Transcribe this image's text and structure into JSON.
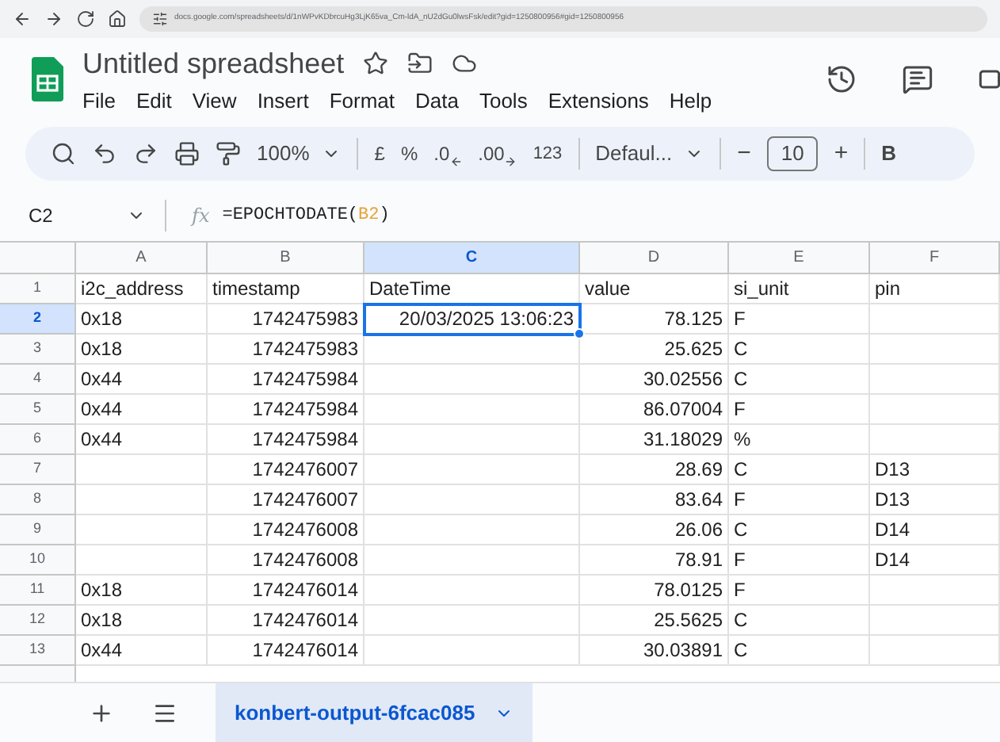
{
  "browser": {
    "url": "docs.google.com/spreadsheets/d/1nWPvKDbrcuHg3LjK65va_Cm-ldA_nU2dGu0lwsFsk/edit?gid=1250800956#gid=1250800956"
  },
  "document": {
    "title": "Untitled spreadsheet",
    "menu": [
      "File",
      "Edit",
      "View",
      "Insert",
      "Format",
      "Data",
      "Tools",
      "Extensions",
      "Help"
    ]
  },
  "toolbar": {
    "zoom": "100%",
    "currency": "£",
    "percent": "%",
    "decrease_decimals": ".0",
    "increase_decimals": ".00",
    "number_format": "123",
    "font": "Defaul...",
    "font_size_decrease": "−",
    "font_size": "10",
    "font_size_increase": "+",
    "bold": "B"
  },
  "formula_bar": {
    "cell_ref": "C2",
    "function_label": "fx",
    "formula_prefix": "=EPOCHTODATE(",
    "formula_ref": "B2",
    "formula_suffix": ")"
  },
  "columns": [
    {
      "label": "A",
      "selected": false
    },
    {
      "label": "B",
      "selected": false
    },
    {
      "label": "C",
      "selected": true
    },
    {
      "label": "D",
      "selected": false
    },
    {
      "label": "E",
      "selected": false
    },
    {
      "label": "F",
      "selected": false
    }
  ],
  "rows": [
    {
      "number": "1",
      "selected": false,
      "cells": [
        "i2c_address",
        "timestamp",
        "DateTime",
        "value",
        "si_unit",
        "pin"
      ]
    },
    {
      "number": "2",
      "selected": true,
      "cells": [
        "0x18",
        "1742475983",
        "20/03/2025 13:06:23",
        "78.125",
        "F",
        null
      ]
    },
    {
      "number": "3",
      "selected": false,
      "cells": [
        "0x18",
        "1742475983",
        null,
        "25.625",
        "C",
        null
      ]
    },
    {
      "number": "4",
      "selected": false,
      "cells": [
        "0x44",
        "1742475984",
        null,
        "30.02556",
        "C",
        null
      ]
    },
    {
      "number": "5",
      "selected": false,
      "cells": [
        "0x44",
        "1742475984",
        null,
        "86.07004",
        "F",
        null
      ]
    },
    {
      "number": "6",
      "selected": false,
      "cells": [
        "0x44",
        "1742475984",
        null,
        "31.18029",
        "%",
        null
      ]
    },
    {
      "number": "7",
      "selected": false,
      "cells": [
        null,
        "1742476007",
        null,
        "28.69",
        "C",
        "D13"
      ]
    },
    {
      "number": "8",
      "selected": false,
      "cells": [
        null,
        "1742476007",
        null,
        "83.64",
        "F",
        "D13"
      ]
    },
    {
      "number": "9",
      "selected": false,
      "cells": [
        null,
        "1742476008",
        null,
        "26.06",
        "C",
        "D14"
      ]
    },
    {
      "number": "10",
      "selected": false,
      "cells": [
        null,
        "1742476008",
        null,
        "78.91",
        "F",
        "D14"
      ]
    },
    {
      "number": "11",
      "selected": false,
      "cells": [
        "0x18",
        "1742476014",
        null,
        "78.0125",
        "F",
        null
      ]
    },
    {
      "number": "12",
      "selected": false,
      "cells": [
        "0x18",
        "1742476014",
        null,
        "25.5625",
        "C",
        null
      ]
    },
    {
      "number": "13",
      "selected": false,
      "cells": [
        "0x44",
        "1742476014",
        null,
        "30.03891",
        "C",
        null
      ]
    }
  ],
  "sheet_tabs": [
    {
      "label": "konbert-output-6fcac085",
      "selected": true
    }
  ]
}
